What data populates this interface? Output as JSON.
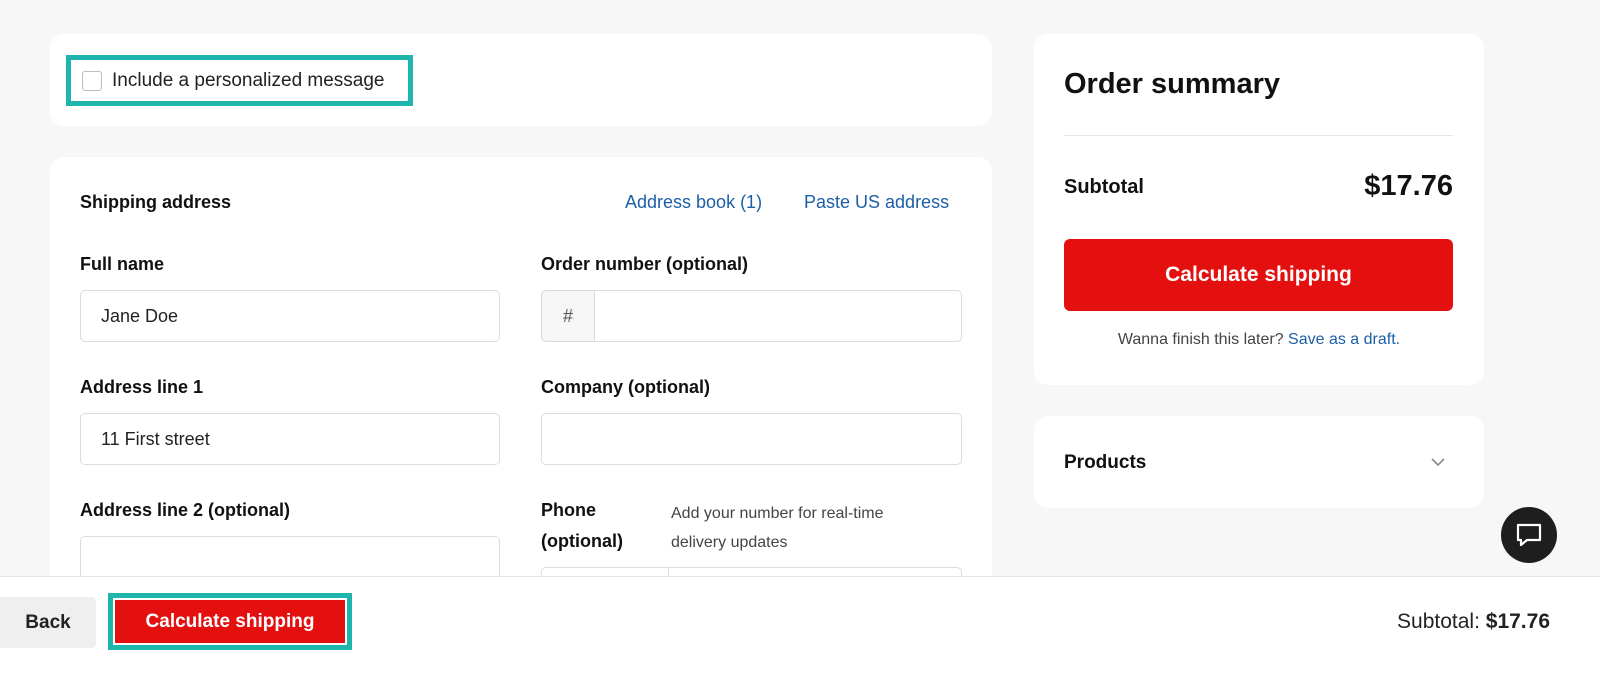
{
  "message_option": {
    "label": "Include a personalized message",
    "checked": false
  },
  "shipping": {
    "title": "Shipping address",
    "links": {
      "address_book": "Address book (1)",
      "paste_us": "Paste US address"
    },
    "full_name": {
      "label": "Full name",
      "value": "Jane Doe"
    },
    "order_number": {
      "label": "Order number (optional)",
      "prefix": "#",
      "value": ""
    },
    "address1": {
      "label": "Address line 1",
      "value": "11 First street"
    },
    "company": {
      "label": "Company (optional)",
      "value": ""
    },
    "address2": {
      "label": "Address line 2 (optional)",
      "value": ""
    },
    "phone": {
      "label": "Phone (optional)",
      "hint": "Add your number for real-time delivery updates",
      "value": ""
    }
  },
  "summary": {
    "title": "Order summary",
    "subtotal_label": "Subtotal",
    "subtotal_value": "$17.76",
    "calc_button": "Calculate shipping",
    "draft_text": "Wanna finish this later?",
    "draft_link": "Save as a draft."
  },
  "products": {
    "label": "Products"
  },
  "bottom_bar": {
    "back": "Back",
    "calc_button": "Calculate shipping",
    "subtotal_label": "Subtotal:",
    "subtotal_value": "$17.76"
  },
  "colors": {
    "accent_red": "#e40f0f",
    "highlight_teal": "#1fb5ad",
    "link_blue": "#1d5fa6"
  }
}
